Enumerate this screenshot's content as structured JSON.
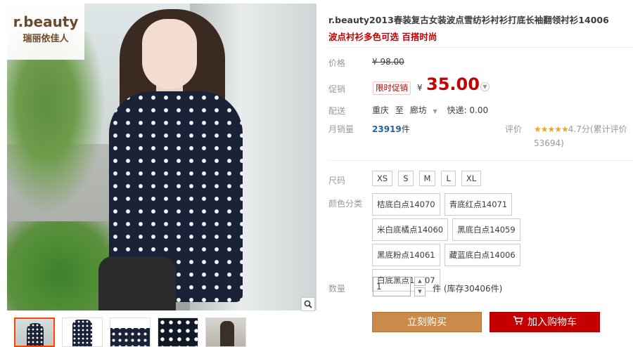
{
  "gallery": {
    "brand_name": "r.beauty",
    "brand_sub": "瑞丽依佳人",
    "zoom_icon": "magnifier-icon",
    "thumbnails": [
      "thumb-1",
      "thumb-2",
      "thumb-3",
      "thumb-4",
      "thumb-5"
    ]
  },
  "product": {
    "title": "r.beauty2013春装复古女装波点雪纺衫衬衫打底长袖翻领衬衫14006",
    "subtitle": "波点衬衫多色可选 百搭时尚"
  },
  "price": {
    "label": "价格",
    "original": "¥ 98.00",
    "promo_label": "促销",
    "promo_tag": "限时促销",
    "currency": "¥",
    "current": "35.00"
  },
  "shipping": {
    "label": "配送",
    "from": "重庆",
    "to_word": "至",
    "to": "廊坊",
    "express": "快递: 0.00"
  },
  "sales": {
    "label": "月销量",
    "count": "23919",
    "unit": "件"
  },
  "rating": {
    "label": "评价",
    "stars": "★★★★★",
    "score": "4.7分",
    "total": "(累计评价53694)"
  },
  "sizes": {
    "label": "尺码",
    "options": [
      "XS",
      "S",
      "M",
      "L",
      "XL"
    ]
  },
  "colors": {
    "label": "颜色分类",
    "options": [
      "桔底白点14070",
      "青底红点14071",
      "米白底橘点14060",
      "黑底白点14059",
      "黑底粉点14061",
      "藏蓝底白点14006",
      "白底黑点14007"
    ]
  },
  "quantity": {
    "label": "数量",
    "value": "1",
    "stock": "件 (库存30406件)"
  },
  "actions": {
    "buy_now": "立刻购买",
    "add_to_cart": "加入购物车"
  },
  "colors_theme": {
    "accent_red": "#c40000",
    "buy_brown": "#c98a4a"
  }
}
